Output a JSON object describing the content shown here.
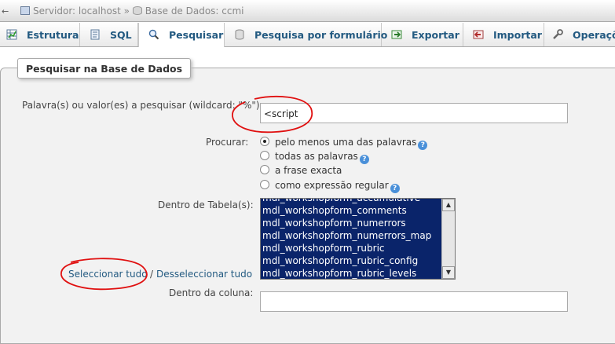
{
  "breadcrumb": {
    "server_label": "Servidor: localhost",
    "separator": "»",
    "database_label": "Base de Dados: ccmi"
  },
  "tabs": [
    {
      "label": "Estrutura",
      "icon": "structure-icon",
      "active": false
    },
    {
      "label": "SQL",
      "icon": "sql-icon",
      "active": false
    },
    {
      "label": "Pesquisar",
      "icon": "search-icon",
      "active": true
    },
    {
      "label": "Pesquisa por formulário",
      "icon": "query-form-icon",
      "active": false
    },
    {
      "label": "Exportar",
      "icon": "export-icon",
      "active": false
    },
    {
      "label": "Importar",
      "icon": "import-icon",
      "active": false
    },
    {
      "label": "Operaçõ",
      "icon": "operations-icon",
      "active": false
    }
  ],
  "form": {
    "legend": "Pesquisar na Base de Dados",
    "search_label": "Palavra(s) ou valor(es) a pesquisar (wildcard: \"%\"):",
    "search_value": "<script",
    "find_label": "Procurar:",
    "options": [
      {
        "label": "pelo menos uma das palavras",
        "checked": true
      },
      {
        "label": "todas as palavras",
        "checked": false
      },
      {
        "label": "a frase exacta",
        "checked": false
      },
      {
        "label": "como expressão regular",
        "checked": false
      }
    ],
    "tables_label": "Dentro de Tabela(s):",
    "tables": [
      "mdl_workshopform_accumulative",
      "mdl_workshopform_comments",
      "mdl_workshopform_numerrors",
      "mdl_workshopform_numerrors_map",
      "mdl_workshopform_rubric",
      "mdl_workshopform_rubric_config",
      "mdl_workshopform_rubric_levels"
    ],
    "select_all": "Seleccionar tudo",
    "link_separator": "/",
    "deselect_all": "Desseleccionar tudo",
    "column_label": "Dentro da coluna:",
    "column_value": ""
  },
  "colors": {
    "link": "#235a81",
    "selected_list": "#0a246a",
    "annotation": "#e01010"
  }
}
